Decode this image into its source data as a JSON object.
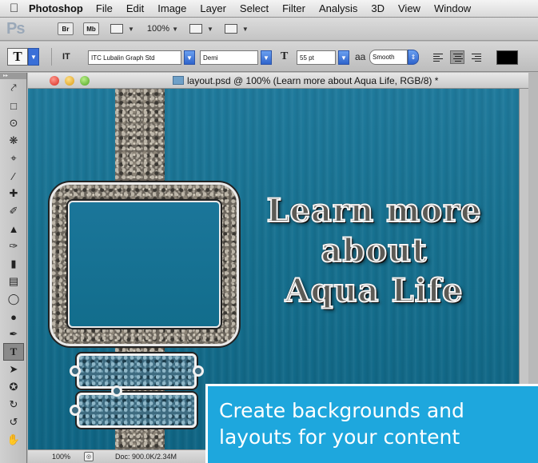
{
  "menubar": {
    "app": "Photoshop",
    "items": [
      "File",
      "Edit",
      "Image",
      "Layer",
      "Select",
      "Filter",
      "Analysis",
      "3D",
      "View",
      "Window"
    ]
  },
  "appbar": {
    "logo": "Ps",
    "bridge": "Br",
    "mini_bridge": "Mb",
    "zoom": "100%"
  },
  "options": {
    "tool_glyph": "T",
    "orientation_glyph": "IT",
    "font_family": "ITC Lubalin Graph Std",
    "font_style": "Demi",
    "size_glyph": "T",
    "font_size": "55 pt",
    "aa_glyph": "aa",
    "antialias": "Smooth",
    "text_color": "#000000"
  },
  "document": {
    "title": "layout.psd @ 100% (Learn more about Aqua Life, RGB/8) *",
    "headline": [
      "Learn more",
      "about",
      "Aqua Life"
    ],
    "status_zoom": "100%",
    "status_doc": "Doc: 900.0K/2.34M"
  },
  "callout": {
    "lines": [
      "Create backgrounds and",
      "layouts for your content"
    ]
  },
  "tools": [
    "move-icon",
    "marquee-icon",
    "lasso-icon",
    "quick-select-icon",
    "crop-icon",
    "eyedropper-icon",
    "healing-icon",
    "brush-icon",
    "stamp-icon",
    "history-brush-icon",
    "eraser-icon",
    "gradient-icon",
    "blur-icon",
    "dodge-icon",
    "pen-icon",
    "type-icon",
    "path-select-icon",
    "shape-icon",
    "3d-rotate-icon",
    "3d-orbit-icon",
    "hand-icon"
  ]
}
